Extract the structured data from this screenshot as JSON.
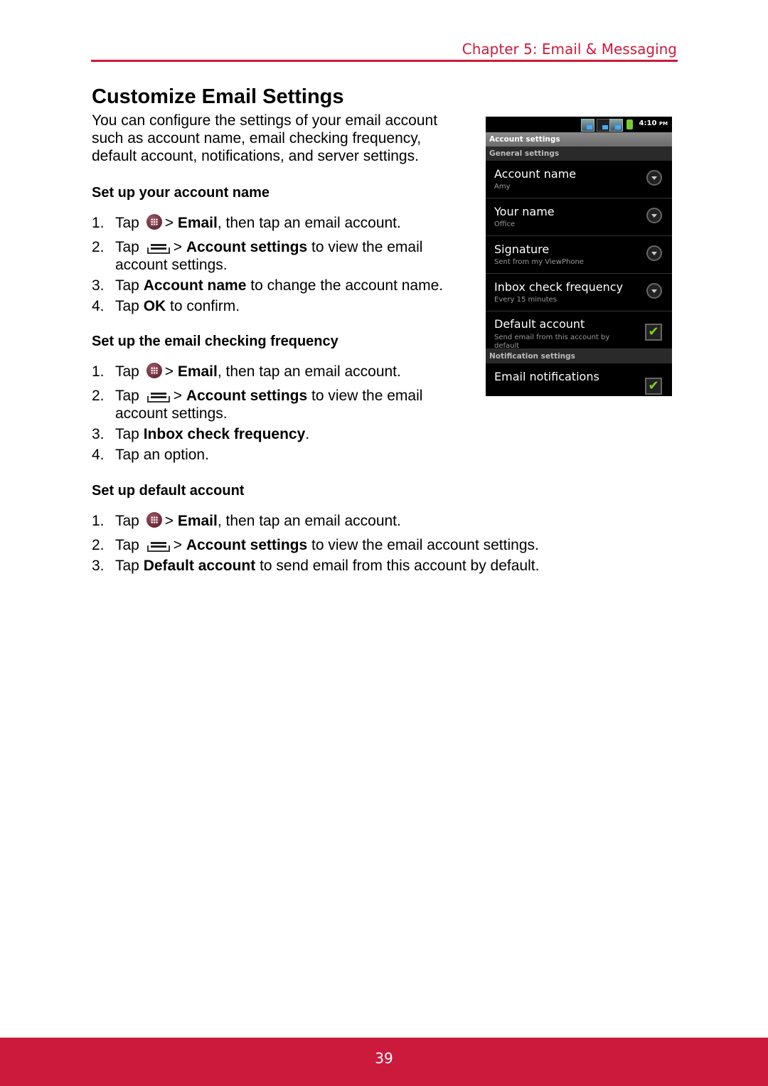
{
  "header": {
    "chapter": "Chapter 5: Email & Messaging"
  },
  "title": "Customize Email Settings",
  "intro": "You can configure the settings of your email account such as account name, email checking frequency, default account, notifications, and server settings.",
  "sections": [
    {
      "heading": "Set up your account name",
      "steps": [
        {
          "num": "1.",
          "pre": "Tap",
          "icon": "apps-icon",
          "sep": ">",
          "bold": "Email",
          "post": ", then tap an email account."
        },
        {
          "num": "2.",
          "pre": "Tap",
          "icon": "menu-icon",
          "sep": ">",
          "bold": "Account settings",
          "post": " to view the email account settings."
        },
        {
          "num": "3.",
          "pre": "Tap ",
          "bold": "Account name",
          "post": " to change the account name."
        },
        {
          "num": "4.",
          "pre": "Tap ",
          "bold": "OK",
          "post": " to confirm."
        }
      ]
    },
    {
      "heading": "Set up the email checking frequency",
      "steps": [
        {
          "num": "1.",
          "pre": "Tap",
          "icon": "apps-icon",
          "sep": ">",
          "bold": "Email",
          "post": ", then tap an email account."
        },
        {
          "num": "2.",
          "pre": "Tap",
          "icon": "menu-icon",
          "sep": ">",
          "bold": "Account settings",
          "post": " to view the email account settings."
        },
        {
          "num": "3.",
          "pre": "Tap ",
          "bold": "Inbox check frequency",
          "post": "."
        },
        {
          "num": "4.",
          "pre": "Tap an option.",
          "bold": "",
          "post": ""
        }
      ]
    },
    {
      "heading": "Set up default account",
      "steps": [
        {
          "num": "1.",
          "pre": "Tap",
          "icon": "apps-icon",
          "sep": ">",
          "bold": "Email",
          "post": ", then tap an email account."
        },
        {
          "num": "2.",
          "pre": "Tap",
          "icon": "menu-icon",
          "sep": ">",
          "bold": "Account settings",
          "post": " to view the email account settings."
        },
        {
          "num": "3.",
          "pre": "Tap ",
          "bold": "Default account",
          "post": " to send email from this account by default."
        }
      ]
    }
  ],
  "phone": {
    "time": "4:10",
    "ampm": "PM",
    "title": "Account settings",
    "general_header": "General settings",
    "notification_header": "Notification settings",
    "prefs": [
      {
        "title": "Account name",
        "summary": "Amy",
        "widget": "dropdown"
      },
      {
        "title": "Your name",
        "summary": "Office",
        "widget": "dropdown"
      },
      {
        "title": "Signature",
        "summary": "Sent from my ViewPhone",
        "widget": "dropdown"
      },
      {
        "title": "Inbox check frequency",
        "summary": "Every 15 minutes",
        "widget": "dropdown"
      },
      {
        "title": "Default account",
        "summary": "Send email from this account by default",
        "widget": "checkbox",
        "checked": true
      }
    ],
    "notif": {
      "title": "Email notifications",
      "checked": true
    },
    "check_glyph": "✔"
  },
  "footer": {
    "page": "39"
  }
}
